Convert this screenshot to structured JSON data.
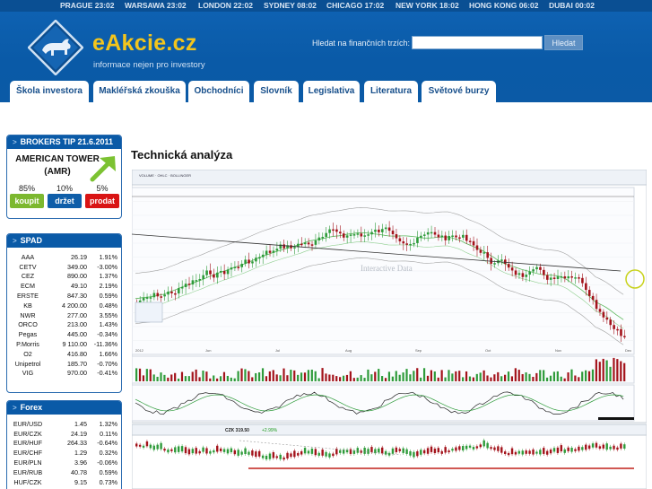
{
  "clocks": [
    {
      "label": "PRAGUE 23:02"
    },
    {
      "label": "WARSAWA 23:02"
    },
    {
      "label": "LONDON 22:02"
    },
    {
      "label": "SYDNEY 08:02"
    },
    {
      "label": "CHICAGO 17:02"
    },
    {
      "label": "NEW YORK 18:02"
    },
    {
      "label": "HONG KONG 06:02"
    },
    {
      "label": "DUBAI 00:02"
    }
  ],
  "brand": {
    "name": "eAkcie.cz",
    "tagline": "informace nejen pro investory"
  },
  "search": {
    "label": "Hledat na finančních trzích:",
    "value": "",
    "button": "Hledat"
  },
  "nav": {
    "tabs": [
      {
        "label": "Škola investora"
      },
      {
        "label": "Makléřská zkouška"
      },
      {
        "label": "Obchodníci"
      },
      {
        "label": "Slovník"
      },
      {
        "label": "Legislativa"
      },
      {
        "label": "Literatura"
      },
      {
        "label": "Světové burzy"
      }
    ]
  },
  "tip": {
    "title": "BROKERS TIP 21.6.2011",
    "stock": "AMERICAN TOWER (AMR)",
    "buy_pct": "85%",
    "hold_pct": "10%",
    "sell_pct": "5%",
    "buy_label": "koupit",
    "hold_label": "držet",
    "sell_label": "prodat",
    "colors": {
      "buy": "#7cb82f",
      "hold": "#0f5ea9",
      "sell": "#d91414",
      "arrow": "#7cc232"
    }
  },
  "spad": {
    "title": "SPAD",
    "rows": [
      {
        "name": "AAA",
        "price": "26.19",
        "change": "1.91%",
        "dir": "up"
      },
      {
        "name": "CETV",
        "price": "349.00",
        "change": "-3.00%",
        "dir": "down"
      },
      {
        "name": "CEZ",
        "price": "890.00",
        "change": "1.37%",
        "dir": "up"
      },
      {
        "name": "ECM",
        "price": "49.10",
        "change": "2.19%",
        "dir": "up"
      },
      {
        "name": "ERSTE",
        "price": "847.30",
        "change": "0.59%",
        "dir": "up"
      },
      {
        "name": "KB",
        "price": "4 200.00",
        "change": "0.48%",
        "dir": "up"
      },
      {
        "name": "NWR",
        "price": "277.00",
        "change": "3.55%",
        "dir": "up"
      },
      {
        "name": "ORCO",
        "price": "213.00",
        "change": "1.43%",
        "dir": "up"
      },
      {
        "name": "Pegas",
        "price": "445.00",
        "change": "-0.34%",
        "dir": "down"
      },
      {
        "name": "P.Morris",
        "price": "9 110.00",
        "change": "-11.36%",
        "dir": "down"
      },
      {
        "name": "O2",
        "price": "416.80",
        "change": "1.66%",
        "dir": "up"
      },
      {
        "name": "Unipetrol",
        "price": "185.70",
        "change": "-0.70%",
        "dir": "down"
      },
      {
        "name": "VIG",
        "price": "970.00",
        "change": "-0.41%",
        "dir": "down"
      }
    ]
  },
  "forex": {
    "title": "Forex",
    "rows": [
      {
        "name": "EUR/USD",
        "price": "1.45",
        "change": "1.32%",
        "dir": "up"
      },
      {
        "name": "EUR/CZK",
        "price": "24.19",
        "change": "0.11%",
        "dir": "up"
      },
      {
        "name": "EUR/HUF",
        "price": "264.33",
        "change": "-0.64%",
        "dir": "down"
      },
      {
        "name": "EUR/CHF",
        "price": "1.29",
        "change": "0.32%",
        "dir": "up"
      },
      {
        "name": "EUR/PLN",
        "price": "3.96",
        "change": "-0.06%",
        "dir": "down"
      },
      {
        "name": "EUR/RUB",
        "price": "40.78",
        "change": "0.59%",
        "dir": "up"
      },
      {
        "name": "HUF/CZK",
        "price": "9.15",
        "change": "0.73%",
        "dir": "up"
      }
    ]
  },
  "main": {
    "title": "Technická analýza",
    "chart_watermark": "Interactive Data",
    "chart_months": [
      "2012",
      "Jun",
      "Jul",
      "Aug",
      "Sep",
      "Oct",
      "Nov",
      "Dec"
    ],
    "chart2_title": "CZK 319.50",
    "chart2_change": "+2.99%"
  },
  "colors": {
    "brand_blue": "#0a5aa7",
    "brand_yellow": "#f3c51c",
    "up": "#1d9a1d",
    "down": "#d01515"
  }
}
